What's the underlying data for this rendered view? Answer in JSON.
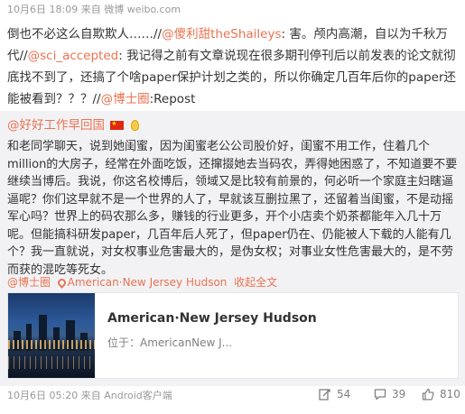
{
  "post_meta": {
    "date_time": "10月6日 18:09",
    "source_prefix": "来自",
    "source": "微博 weibo.com"
  },
  "repost_text": {
    "line1_pre": "倒也不必这么自欺欺人……//",
    "mention1": "@傻利甜theShaileys",
    "line1_post": ": 害。颅内高潮，自以为千秋万代//",
    "mention2": "@sci_accepted",
    "line2": ": 我记得之前有文章说现在很多期刊停刊后以前发表的论文就彻底找不到了，还搞了个啥paper保护计划之类的，所以你确定几百年后你的paper还能被看到？？？//",
    "mention3": "@博士圈",
    "tail": ":Repost"
  },
  "original": {
    "author": "@好好工作早回国",
    "text": "和老同学聊天，说到她闺蜜，因为闺蜜老公公司股价好，闺蜜不用工作，住着几个million的大房子，经常在外面吃饭，还撺掇她去当码农，弄得她困惑了，不知道要不要继续当博后。我说，你这名校博后，领域又是比较有前景的，何必听一个家庭主妇瞎逼逼呢？你们这早就不是一个世界的人了，早就该互删拉黑了，还留着当闺蜜，不是动摇军心吗？世界上的码农那么多，赚钱的行业更多，开个小店卖个奶茶都能年入几十万呢。但能搞科研发paper，几百年后人死了，但paper仍在、仍能被人下载的人能有几个？我一直就说，对女权事业危害最大的，是伪女权；对事业女性危害最大的，是不劳而获的混吃等死女。",
    "links": {
      "author": "@博士圈",
      "location": "American·New Jersey Hudson",
      "expand": "收起全文"
    },
    "card": {
      "title": "American·New Jersey Hudson",
      "subtitle": "位于：AmericanNew J..."
    }
  },
  "footer": {
    "date_time": "10月6日 05:20",
    "source_prefix": "来自",
    "source": "Android客户端",
    "repost_count": "54",
    "comment_count": "39",
    "like_count": "810"
  },
  "colors": {
    "link": "#eb7350",
    "meta": "#999999",
    "original_bg": "#f2f2f5"
  }
}
